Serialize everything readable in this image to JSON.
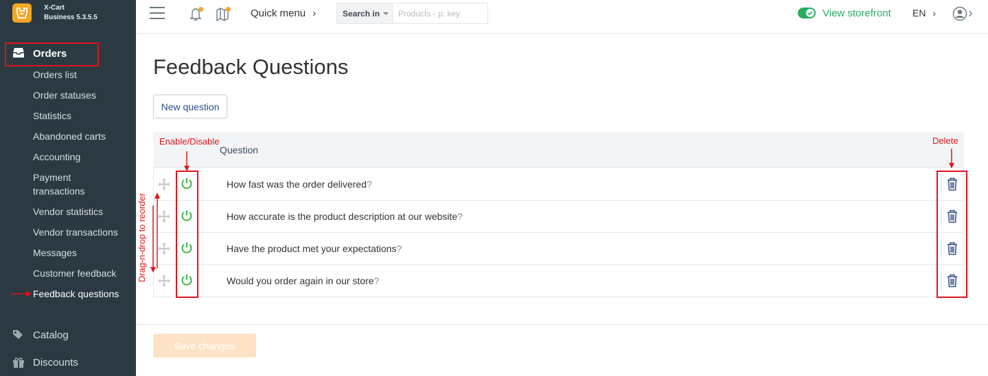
{
  "brand": {
    "line1": "X-Cart",
    "line2": "Business 5.3.5.5",
    "logo_color": "#f5a623"
  },
  "sidebar": {
    "orders_label": "Orders",
    "items": [
      {
        "label": "Orders list"
      },
      {
        "label": "Order statuses"
      },
      {
        "label": "Statistics"
      },
      {
        "label": "Abandoned carts"
      },
      {
        "label": "Accounting"
      },
      {
        "label": "Payment"
      },
      {
        "label": "transactions"
      },
      {
        "label": "Vendor statistics"
      },
      {
        "label": "Vendor transactions"
      },
      {
        "label": "Messages"
      },
      {
        "label": "Customer feedback"
      },
      {
        "label": "Feedback questions"
      }
    ],
    "catalog_label": "Catalog",
    "discounts_label": "Discounts"
  },
  "topbar": {
    "quick_menu": "Quick menu",
    "search_in_label": "Search in",
    "search_placeholder": "Products - p: key",
    "view_storefront": "View storefront",
    "language": "EN",
    "accent_color": "#27ae60"
  },
  "main": {
    "title": "Feedback Questions",
    "new_question_button": "New question",
    "column_question": "Question",
    "rows": [
      {
        "question": "How fast was the order delivered",
        "mark": "?"
      },
      {
        "question": "How accurate is the product description at our website",
        "mark": "?"
      },
      {
        "question": "Have the product met your expectations",
        "mark": "?"
      },
      {
        "question": "Would you order again in our store",
        "mark": "?"
      }
    ],
    "save_button": "Save changes"
  },
  "annotations": {
    "enable_disable": "Enable/Disable",
    "delete": "Delete",
    "drag_reorder": "Drag-n-drop to reorder",
    "color": "#e0141c"
  }
}
